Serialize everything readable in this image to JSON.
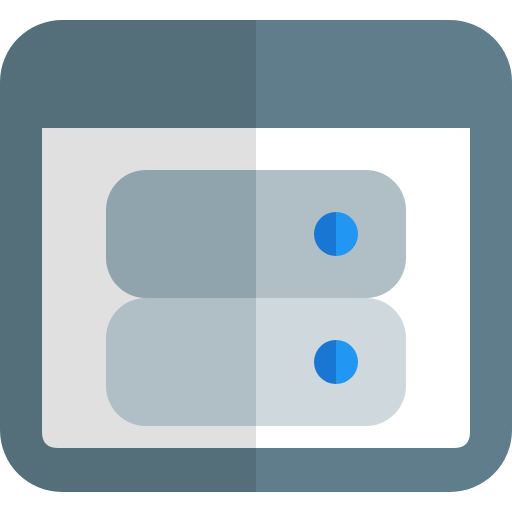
{
  "icon": {
    "name": "server-window-icon",
    "colors": {
      "frame_left": "#546e7a",
      "frame_right": "#607d8b",
      "panel_left": "#e0e0e0",
      "panel_right": "#ffffff",
      "drive_top_left": "#90a4ae",
      "drive_top_right": "#b0bec5",
      "drive_bottom_left": "#b0bec5",
      "drive_bottom_right": "#cfd8dc",
      "led_left": "#1976d2",
      "led_right": "#2196f3"
    }
  }
}
